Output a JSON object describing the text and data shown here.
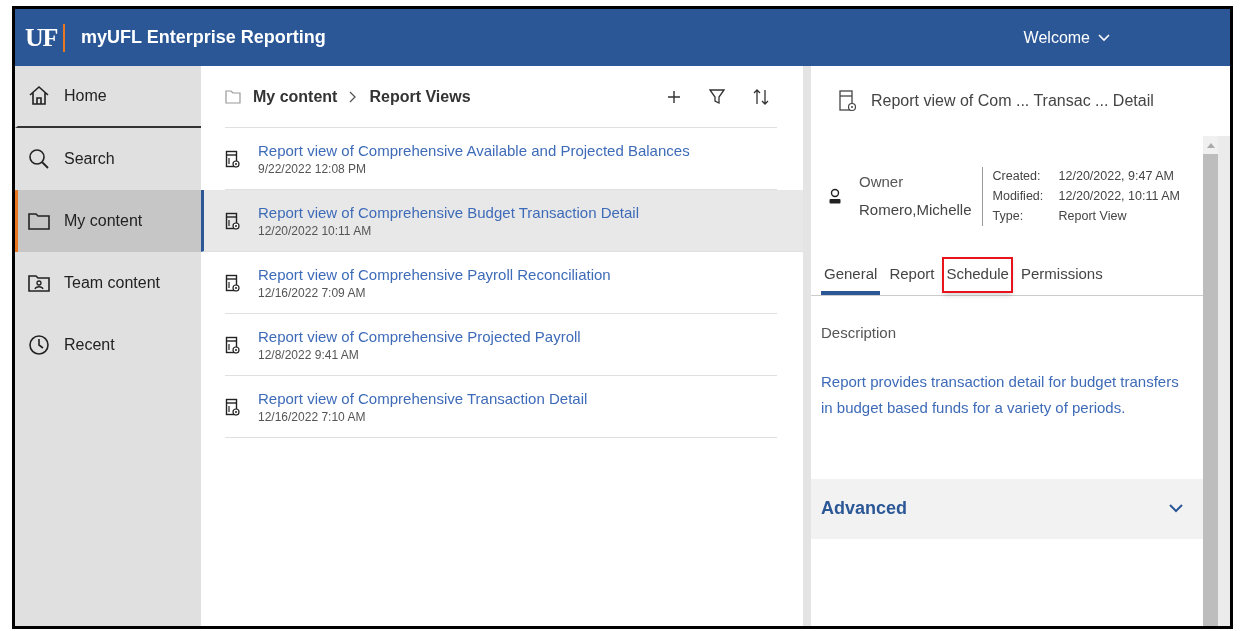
{
  "header": {
    "logo": "UF",
    "title": "myUFL Enterprise Reporting",
    "welcome": "Welcome"
  },
  "sidebar": {
    "items": [
      {
        "label": "Home",
        "kind": "home",
        "selected": false
      },
      {
        "label": "Search",
        "kind": "search",
        "selected": false
      },
      {
        "label": "My content",
        "kind": "folder",
        "selected": true
      },
      {
        "label": "Team content",
        "kind": "team",
        "selected": false
      },
      {
        "label": "Recent",
        "kind": "recent",
        "selected": false
      }
    ]
  },
  "breadcrumb": [
    "My content",
    "Report Views"
  ],
  "list": {
    "rows": [
      {
        "title": "Report view of Comprehensive Available and Projected Balances",
        "date": "9/22/2022 12:08 PM",
        "selected": false
      },
      {
        "title": "Report view of Comprehensive Budget Transaction Detail",
        "date": "12/20/2022 10:11 AM",
        "selected": true
      },
      {
        "title": "Report view of Comprehensive Payroll Reconciliation",
        "date": "12/16/2022 7:09 AM",
        "selected": false
      },
      {
        "title": "Report view of Comprehensive Projected Payroll",
        "date": "12/8/2022 9:41 AM",
        "selected": false
      },
      {
        "title": "Report view of Comprehensive Transaction Detail",
        "date": "12/16/2022 7:10 AM",
        "selected": false
      }
    ]
  },
  "details": {
    "title": "Report view of Com ... Transac ... Detail",
    "owner_label": "Owner",
    "owner": "Romero,Michelle",
    "properties": [
      {
        "label": "Created:",
        "value": "12/20/2022, 9:47 AM"
      },
      {
        "label": "Modified:",
        "value": "12/20/2022, 10:11 AM"
      },
      {
        "label": "Type:",
        "value": "Report View"
      }
    ],
    "tabs": [
      {
        "label": "General",
        "selected": true,
        "highlighted": false
      },
      {
        "label": "Report",
        "selected": false,
        "highlighted": false
      },
      {
        "label": "Schedule",
        "selected": false,
        "highlighted": true
      },
      {
        "label": "Permissions",
        "selected": false,
        "highlighted": false
      }
    ],
    "description_label": "Description",
    "description": "Report provides transaction detail for budget transfers in budget based funds for a variety of periods.",
    "advanced": {
      "label": "Advanced",
      "expanded": false
    }
  }
}
